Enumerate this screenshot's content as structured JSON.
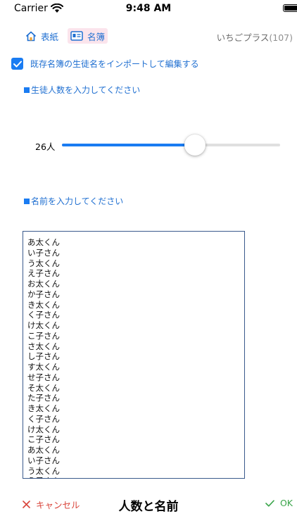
{
  "status_bar": {
    "carrier": "Carrier",
    "time": "9:48 AM"
  },
  "nav": {
    "home_label": "表紙",
    "roster_label": "名簿",
    "app_name": "いちごプラス",
    "app_count": "(107)"
  },
  "import": {
    "checked": true,
    "label": "既存名簿の生徒名をインポートして編集する"
  },
  "student_count": {
    "label": "生徒人数を入力してください",
    "value_label": "26人",
    "slider_fraction": 0.61
  },
  "names": {
    "label": "名前を入力してください",
    "lines": [
      "あ太くん",
      "い子さん",
      "う太くん",
      "え子さん",
      "お太くん",
      "か子さん",
      "き太くん",
      "く子さん",
      "け太くん",
      "こ子さん",
      "さ太くん",
      "し子さん",
      "す太くん",
      "せ子さん",
      "そ太くん",
      "た子さん",
      "き太くん",
      "く子さん",
      "け太くん",
      "こ子さん",
      "あ太くん",
      "い子さん",
      "う太くん",
      "え子さん"
    ]
  },
  "toolbar": {
    "cancel_label": "キャンセル",
    "title": "人数と名前",
    "ok_label": "OK"
  },
  "colors": {
    "accent": "#1a7cf2",
    "cancel": "#d9453b",
    "ok": "#3aa54a",
    "roster_highlight": "#fbe4ec"
  }
}
